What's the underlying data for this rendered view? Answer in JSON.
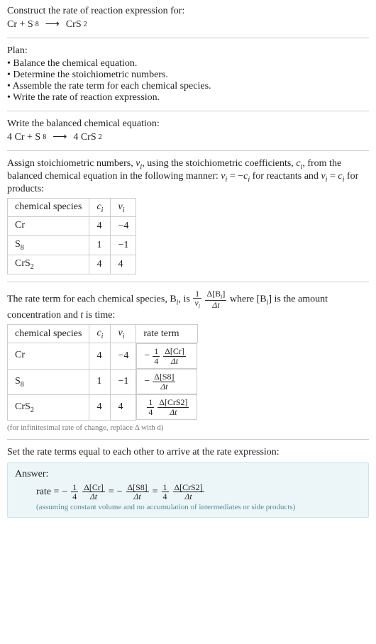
{
  "intro": {
    "construct": "Construct the rate of reaction expression for:",
    "lhs1": "Cr + S",
    "s8_sub": "8",
    "arrow": "⟶",
    "rhs1": "CrS",
    "crs2_sub": "2"
  },
  "plan": {
    "header": "Plan:",
    "items": [
      "Balance the chemical equation.",
      "Determine the stoichiometric numbers.",
      "Assemble the rate term for each chemical species.",
      "Write the rate of reaction expression."
    ]
  },
  "balanced": {
    "header": "Write the balanced chemical equation:",
    "lhs_a": "4 Cr + S",
    "s8_sub": "8",
    "arrow": "⟶",
    "rhs_a": "4 CrS",
    "crs2_sub": "2"
  },
  "assign": {
    "text_a": "Assign stoichiometric numbers, ",
    "nu_i": "ν",
    "sub_i": "i",
    "text_b": ", using the stoichiometric coefficients, ",
    "c_i": "c",
    "text_c": ", from the balanced chemical equation in the following manner: ",
    "eq1_lhs": "ν",
    "eq1_eq": " = −",
    "eq1_rhs": "c",
    "text_d": " for reactants and ",
    "eq2_lhs": "ν",
    "eq2_eq": " = ",
    "eq2_rhs": "c",
    "text_e": " for products:"
  },
  "table1": {
    "headers": {
      "species": "chemical species",
      "c": "c",
      "c_sub": "i",
      "nu": "ν",
      "nu_sub": "i"
    },
    "rows": [
      {
        "species_a": "Cr",
        "species_sub": "",
        "c": "4",
        "nu": "−4"
      },
      {
        "species_a": "S",
        "species_sub": "8",
        "c": "1",
        "nu": "−1"
      },
      {
        "species_a": "CrS",
        "species_sub": "2",
        "c": "4",
        "nu": "4"
      }
    ]
  },
  "rate_term": {
    "text_a": "The rate term for each chemical species, B",
    "sub_i": "i",
    "text_b": ", is ",
    "one": "1",
    "nu_den": "ν",
    "d_num_a": "Δ[B",
    "d_num_b": "]",
    "d_den": "Δt",
    "text_c": " where [B",
    "text_d": "] is the amount concentration and ",
    "t_ital": "t",
    "text_e": " is time:"
  },
  "table2": {
    "headers": {
      "species": "chemical species",
      "c": "c",
      "c_sub": "i",
      "nu": "ν",
      "nu_sub": "i",
      "rate": "rate term"
    },
    "rows": [
      {
        "species_a": "Cr",
        "species_sub": "",
        "c": "4",
        "nu": "−4",
        "rate_sign": "−",
        "rate_num": "1",
        "rate_den": "4",
        "delta_num": "Δ[Cr]",
        "delta_den": "Δt"
      },
      {
        "species_a": "S",
        "species_sub": "8",
        "c": "1",
        "nu": "−1",
        "rate_sign": "−",
        "rate_num": "",
        "rate_den": "",
        "delta_num": "Δ[S8]",
        "delta_den": "Δt"
      },
      {
        "species_a": "CrS",
        "species_sub": "2",
        "c": "4",
        "nu": "4",
        "rate_sign": "",
        "rate_num": "1",
        "rate_den": "4",
        "delta_num": "Δ[CrS2]",
        "delta_den": "Δt"
      }
    ],
    "note": "(for infinitesimal rate of change, replace Δ with d)"
  },
  "set_equal": "Set the rate terms equal to each other to arrive at the rate expression:",
  "answer": {
    "title": "Answer:",
    "rate_label": "rate = ",
    "t1_sign": "−",
    "t1_num": "1",
    "t1_den": "4",
    "t1_dnum": "Δ[Cr]",
    "t1_dden": "Δt",
    "eq": " = ",
    "t2_sign": "−",
    "t2_dnum": "Δ[S8]",
    "t2_dden": "Δt",
    "t3_num": "1",
    "t3_den": "4",
    "t3_dnum": "Δ[CrS2]",
    "t3_dden": "Δt",
    "assumption": "(assuming constant volume and no accumulation of intermediates or side products)"
  }
}
